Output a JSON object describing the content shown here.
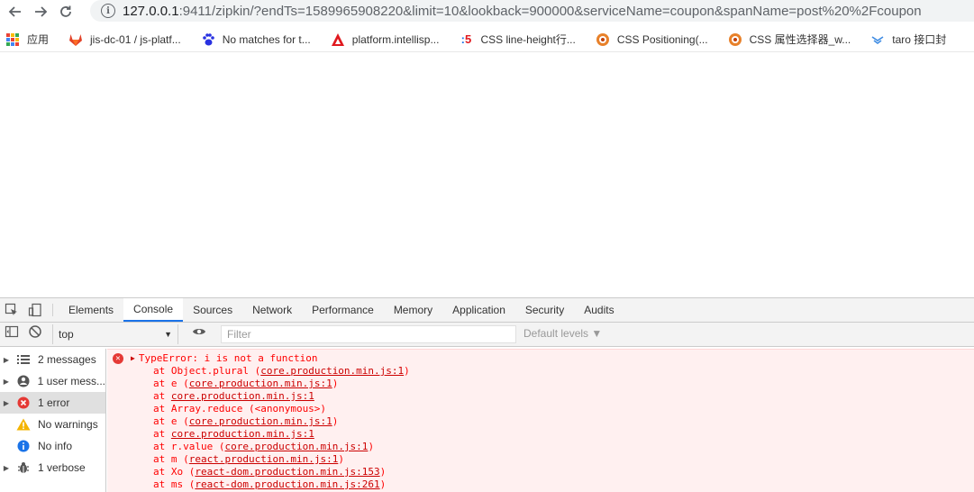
{
  "browser": {
    "url_host": "127.0.0.1",
    "url_path": ":9411/zipkin/?endTs=1589965908220&limit=10&lookback=900000&serviceName=coupon&spanName=post%20%2Fcoupon",
    "bookmarks": [
      {
        "label": "应用",
        "icon": "apps-grid-icon"
      },
      {
        "label": "jis-dc-01 / js-platf...",
        "icon": "gitlab-icon"
      },
      {
        "label": "No matches for t...",
        "icon": "baidu-paw-icon"
      },
      {
        "label": "platform.intellisp...",
        "icon": "red-triangle-icon"
      },
      {
        "label": "CSS line-height行...",
        "icon": "five-icon"
      },
      {
        "label": "CSS Positioning(...",
        "icon": "orange-circle-icon"
      },
      {
        "label": "CSS 属性选择器_w...",
        "icon": "orange-circle-icon"
      },
      {
        "label": "taro 接口封",
        "icon": "taro-icon"
      }
    ]
  },
  "devtools": {
    "tabs": [
      "Elements",
      "Console",
      "Sources",
      "Network",
      "Performance",
      "Memory",
      "Application",
      "Security",
      "Audits"
    ],
    "active_tab": "Console",
    "context": "top",
    "filter_placeholder": "Filter",
    "levels_label": "Default levels ▼",
    "sidebar": [
      {
        "label": "2 messages",
        "icon": "list-icon",
        "expandable": true
      },
      {
        "label": "1 user mess...",
        "icon": "user-icon",
        "expandable": true
      },
      {
        "label": "1 error",
        "icon": "error-icon",
        "expandable": true,
        "selected": true
      },
      {
        "label": "No warnings",
        "icon": "warning-icon",
        "expandable": false
      },
      {
        "label": "No info",
        "icon": "info-icon",
        "expandable": false
      },
      {
        "label": "1 verbose",
        "icon": "bug-icon",
        "expandable": true
      }
    ],
    "error": {
      "message": "TypeError: i is not a function",
      "stack": [
        {
          "prefix": "at Object.plural (",
          "link": "core.production.min.js:1",
          "suffix": ")"
        },
        {
          "prefix": "at e (",
          "link": "core.production.min.js:1",
          "suffix": ")"
        },
        {
          "prefix": "at ",
          "link": "core.production.min.js:1",
          "suffix": ""
        },
        {
          "prefix": "at Array.reduce (<anonymous>)",
          "link": "",
          "suffix": ""
        },
        {
          "prefix": "at e (",
          "link": "core.production.min.js:1",
          "suffix": ")"
        },
        {
          "prefix": "at ",
          "link": "core.production.min.js:1",
          "suffix": ""
        },
        {
          "prefix": "at r.value (",
          "link": "core.production.min.js:1",
          "suffix": ")"
        },
        {
          "prefix": "at m (",
          "link": "react.production.min.js:1",
          "suffix": ")"
        },
        {
          "prefix": "at Xo (",
          "link": "react-dom.production.min.js:153",
          "suffix": ")"
        },
        {
          "prefix": "at ms (",
          "link": "react-dom.production.min.js:261",
          "suffix": ")"
        }
      ]
    }
  }
}
